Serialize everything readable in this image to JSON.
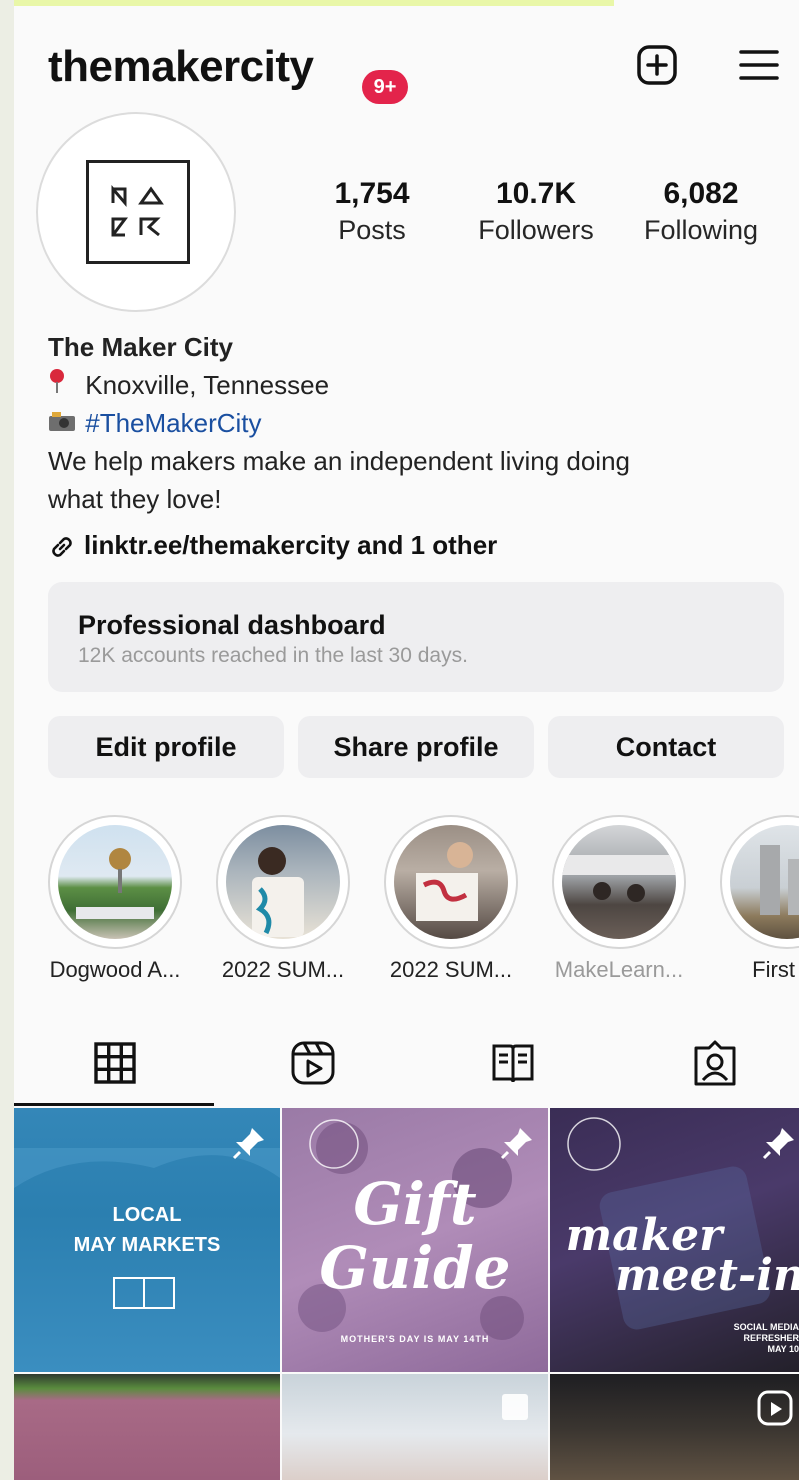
{
  "header": {
    "username": "themakercity",
    "notification_badge": "9+",
    "new_post_icon": "plus-square-icon",
    "menu_icon": "hamburger-menu-icon"
  },
  "profile": {
    "stats": [
      {
        "value": "1,754",
        "label": "Posts"
      },
      {
        "value": "10.7K",
        "label": "Followers"
      },
      {
        "value": "6,082",
        "label": "Following"
      }
    ],
    "bio": {
      "name": "The Maker City",
      "location": "Knoxville, Tennessee",
      "hashtag": "#TheMakerCity",
      "description_line1": "We help makers make an independent living doing",
      "description_line2": "what they love!"
    },
    "link": "linktr.ee/themakercity and 1 other"
  },
  "dashboard": {
    "title": "Professional dashboard",
    "subtitle": "12K accounts reached in the last 30 days."
  },
  "actions": {
    "edit": "Edit profile",
    "share": "Share profile",
    "contact": "Contact"
  },
  "highlights": [
    {
      "label": "Dogwood A..."
    },
    {
      "label": "2022 SUM..."
    },
    {
      "label": "2022 SUM..."
    },
    {
      "label": "MakeLearn..."
    },
    {
      "label": "First Fr"
    }
  ],
  "tabs": [
    "grid-icon",
    "reels-icon",
    "guides-icon",
    "tagged-icon"
  ],
  "posts": [
    {
      "line1": "LOCAL",
      "line2": "MAY MARKETS"
    },
    {
      "line1": "Gift",
      "line2": "Guide",
      "footer": "MOTHER'S DAY IS MAY 14TH"
    },
    {
      "line1": "maker",
      "line2": "meet-in",
      "footer1": "SOCIAL MEDIA",
      "footer2": "REFRESHER",
      "footer3": "MAY 10"
    }
  ],
  "colors": {
    "accent_badge": "#e3244b",
    "link_blue": "#1a4fa0",
    "button_bg": "#eeeef0"
  }
}
